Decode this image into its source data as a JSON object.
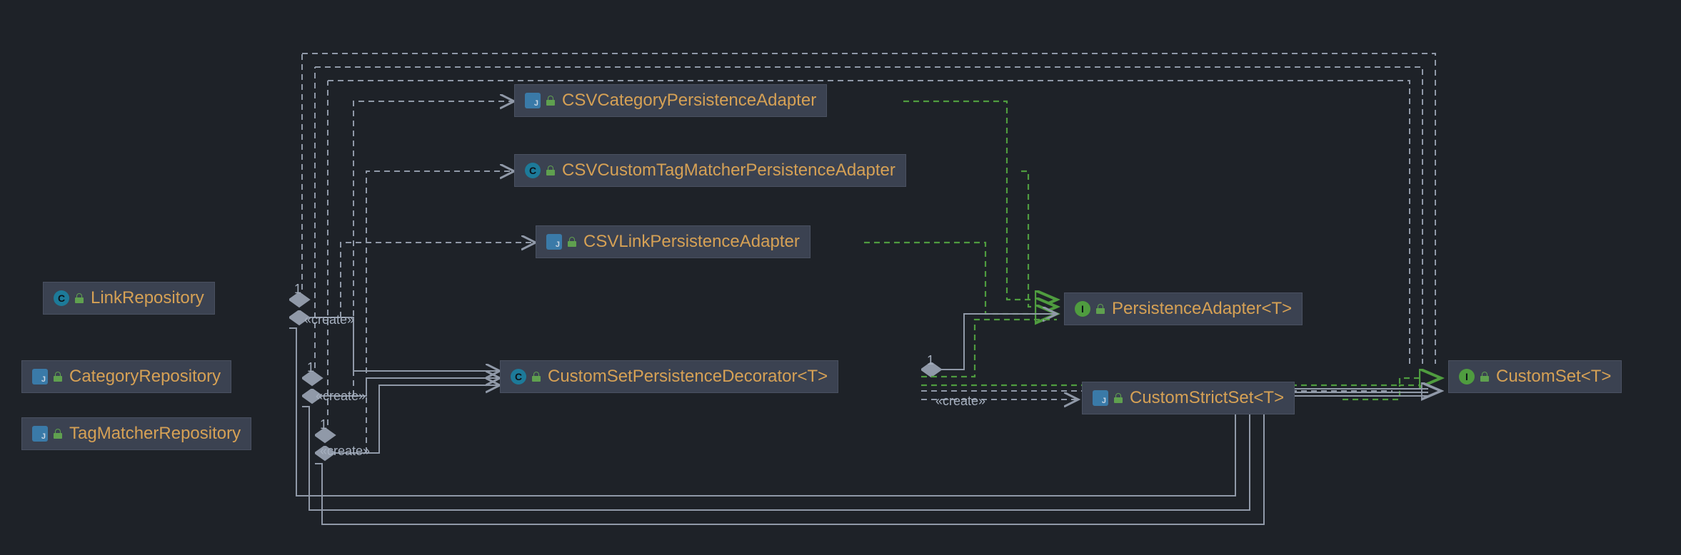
{
  "nodes": {
    "linkRepository": {
      "label": "LinkRepository",
      "type": "class"
    },
    "categoryRepository": {
      "label": "CategoryRepository",
      "type": "java"
    },
    "tagMatcherRepository": {
      "label": "TagMatcherRepository",
      "type": "java"
    },
    "csvCategoryPersistenceAdapter": {
      "label": "CSVCategoryPersistenceAdapter",
      "type": "java"
    },
    "csvCustomTagMatcherPersistenceAdapter": {
      "label": "CSVCustomTagMatcherPersistenceAdapter",
      "type": "class"
    },
    "csvLinkPersistenceAdapter": {
      "label": "CSVLinkPersistenceAdapter",
      "type": "java"
    },
    "customSetPersistenceDecorator": {
      "label": "CustomSetPersistenceDecorator",
      "generic": "<T>",
      "type": "class"
    },
    "persistenceAdapter": {
      "label": "PersistenceAdapter",
      "generic": "<T>",
      "type": "interface"
    },
    "customStrictSet": {
      "label": "CustomStrictSet",
      "generic": "<T>",
      "type": "java"
    },
    "customSet": {
      "label": "CustomSet",
      "generic": "<T>",
      "type": "interface"
    }
  },
  "edgeLabels": {
    "create": "«create»",
    "one": "1"
  },
  "relationships": [
    {
      "from": "LinkRepository",
      "to": "CustomSetPersistenceDecorator",
      "kind": "create-association",
      "multiplicity": "1"
    },
    {
      "from": "CategoryRepository",
      "to": "CustomSetPersistenceDecorator",
      "kind": "create-association",
      "multiplicity": "1"
    },
    {
      "from": "TagMatcherRepository",
      "to": "CustomSetPersistenceDecorator",
      "kind": "create-association",
      "multiplicity": "1"
    },
    {
      "from": "LinkRepository",
      "to": "CSVLinkPersistenceAdapter",
      "kind": "dependency-create"
    },
    {
      "from": "CategoryRepository",
      "to": "CSVCategoryPersistenceAdapter",
      "kind": "dependency-create"
    },
    {
      "from": "TagMatcherRepository",
      "to": "CSVCustomTagMatcherPersistenceAdapter",
      "kind": "dependency-create"
    },
    {
      "from": "LinkRepository",
      "to": "CustomSet",
      "kind": "dependency",
      "multiplicity": "1"
    },
    {
      "from": "CategoryRepository",
      "to": "CustomSet",
      "kind": "dependency",
      "multiplicity": "1"
    },
    {
      "from": "TagMatcherRepository",
      "to": "CustomSet",
      "kind": "dependency",
      "multiplicity": "1"
    },
    {
      "from": "CSVCategoryPersistenceAdapter",
      "to": "PersistenceAdapter",
      "kind": "realization"
    },
    {
      "from": "CSVCustomTagMatcherPersistenceAdapter",
      "to": "PersistenceAdapter",
      "kind": "realization"
    },
    {
      "from": "CSVLinkPersistenceAdapter",
      "to": "PersistenceAdapter",
      "kind": "realization"
    },
    {
      "from": "CustomSetPersistenceDecorator",
      "to": "PersistenceAdapter",
      "kind": "association",
      "multiplicity": "1"
    },
    {
      "from": "CustomSetPersistenceDecorator",
      "to": "PersistenceAdapter",
      "kind": "dependency"
    },
    {
      "from": "CustomSetPersistenceDecorator",
      "to": "CustomStrictSet",
      "kind": "dependency-create"
    },
    {
      "from": "CustomSetPersistenceDecorator",
      "to": "CustomSet",
      "kind": "realization"
    },
    {
      "from": "CustomSetPersistenceDecorator",
      "to": "CustomSet",
      "kind": "dependency"
    },
    {
      "from": "CustomStrictSet",
      "to": "CustomSet",
      "kind": "realization"
    }
  ]
}
